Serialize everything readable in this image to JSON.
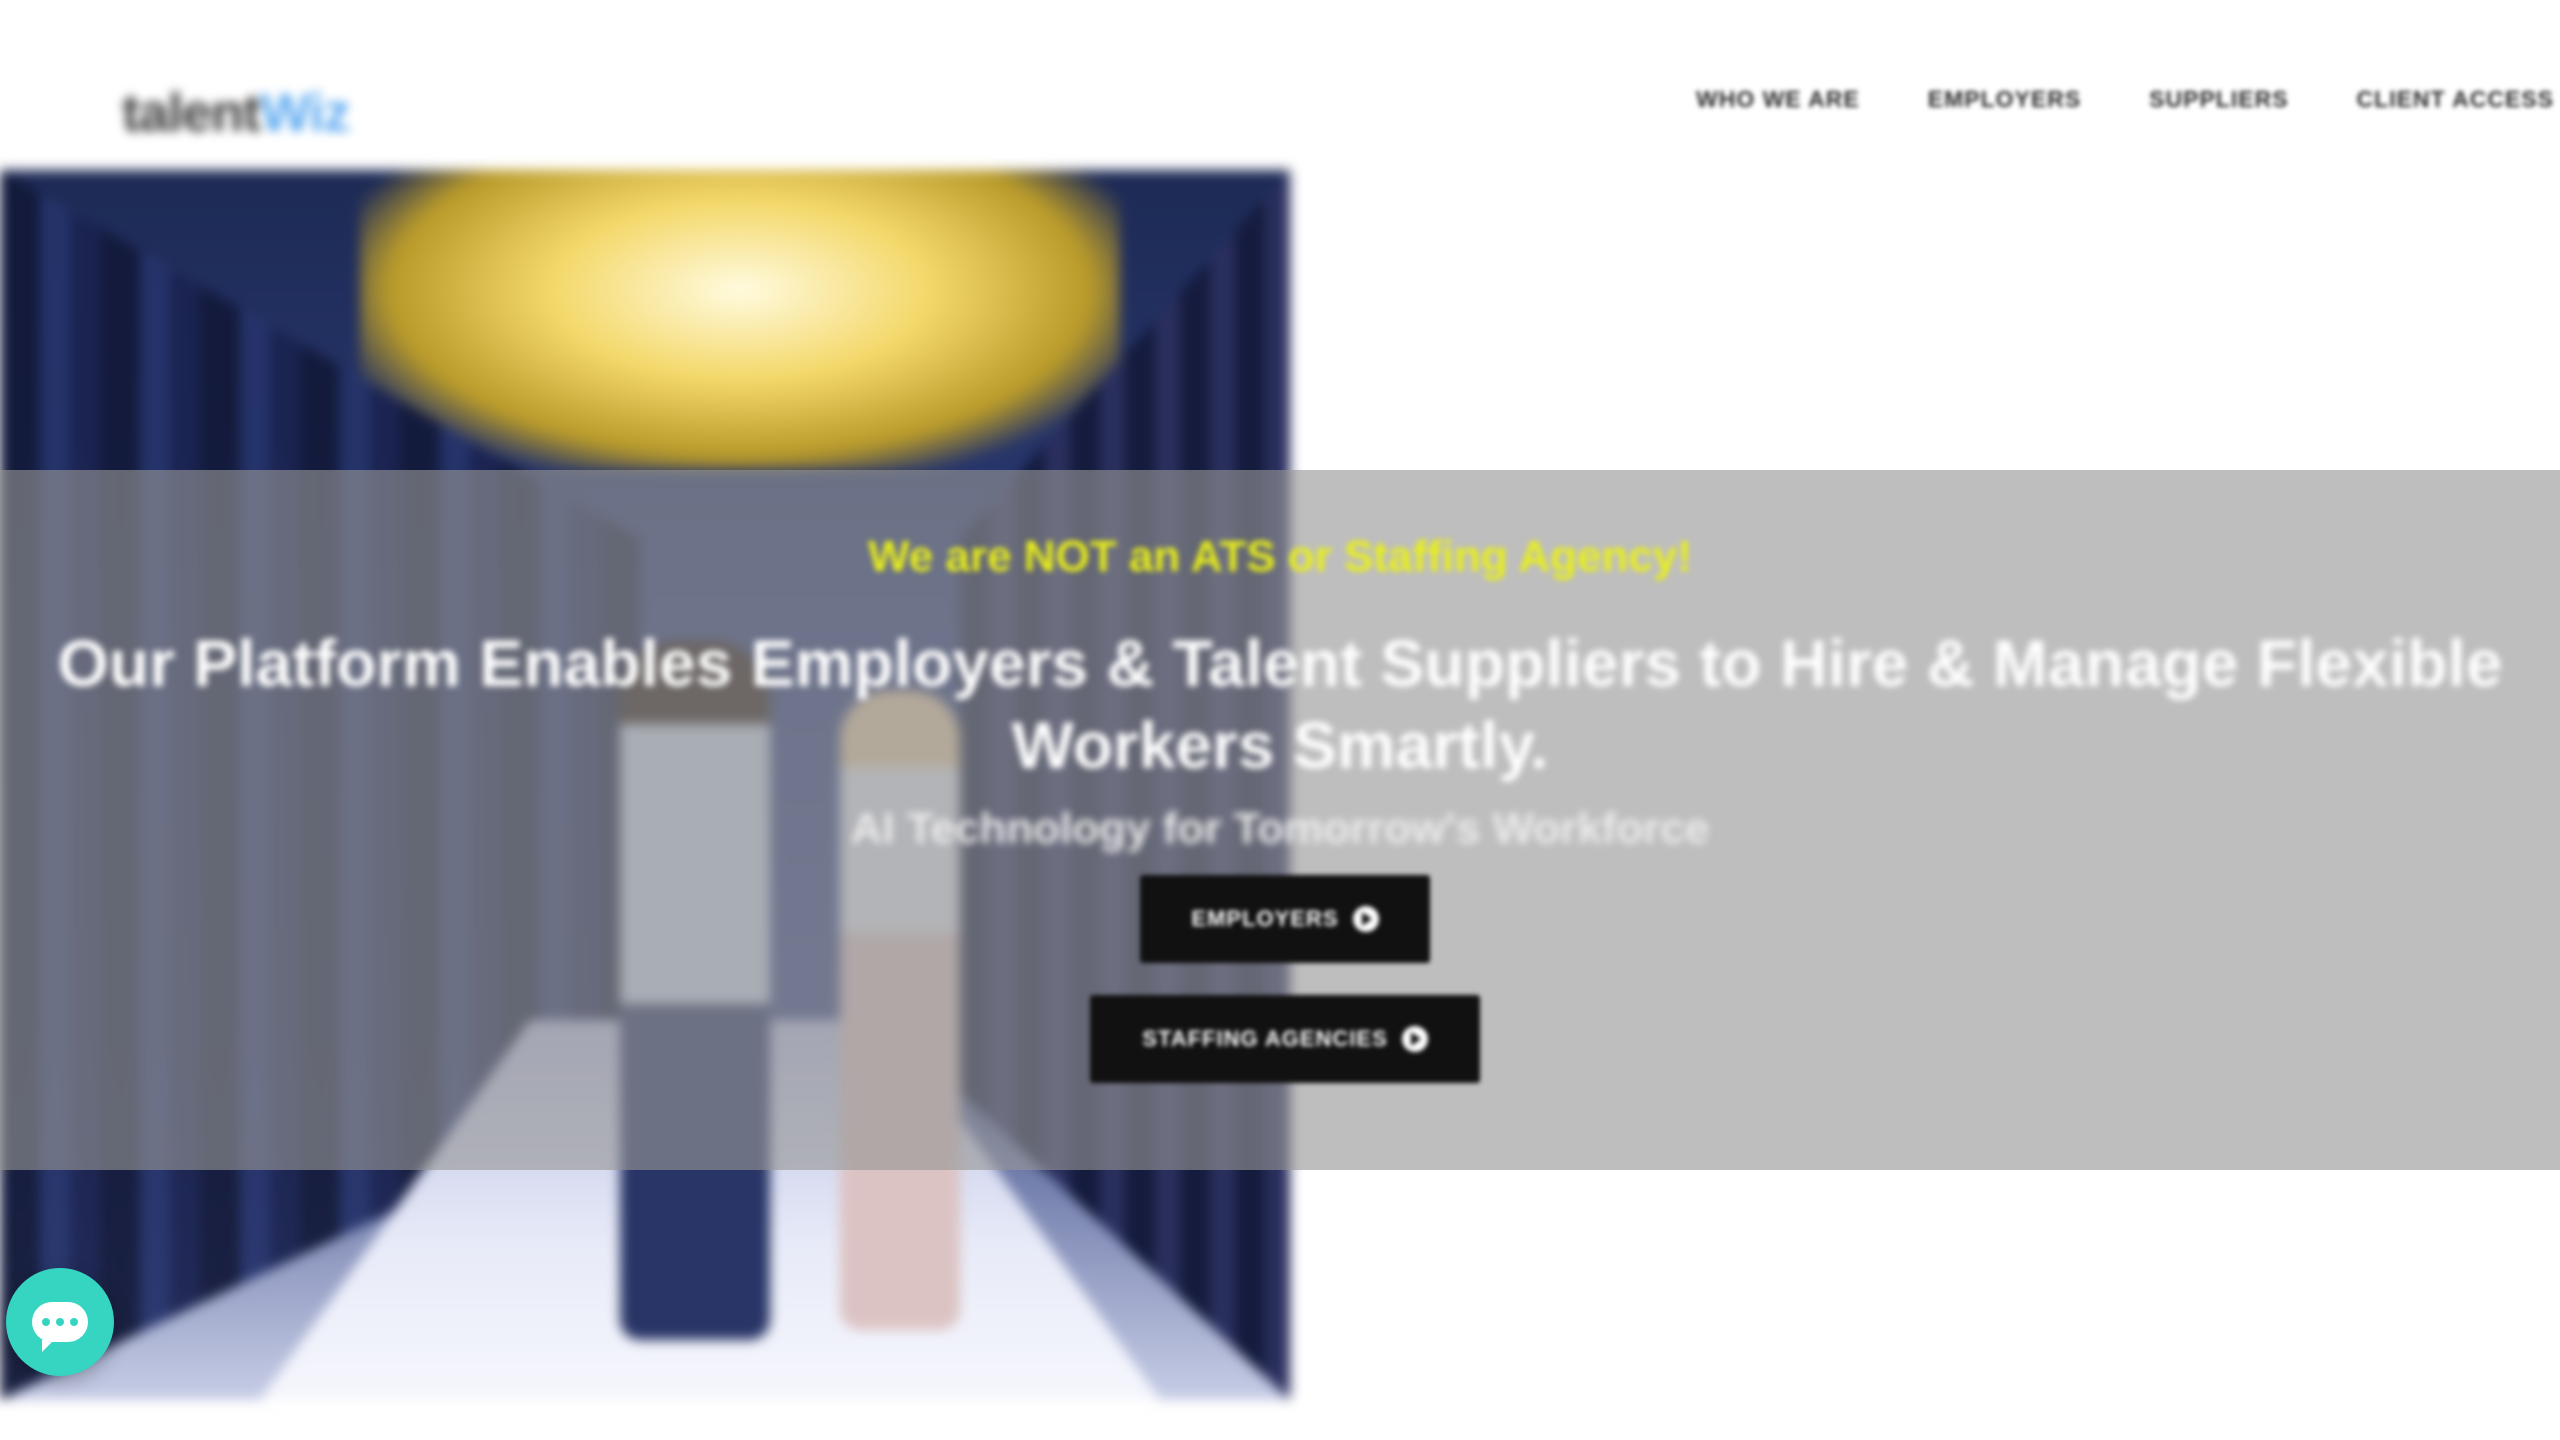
{
  "header": {
    "logo_part1": "talent",
    "logo_part2": "Wiz",
    "nav": [
      {
        "label": "WHO WE ARE"
      },
      {
        "label": "EMPLOYERS"
      },
      {
        "label": "SUPPLIERS"
      },
      {
        "label": "CLIENT ACCESS"
      }
    ]
  },
  "hero": {
    "eyebrow": "We are NOT an ATS or Staffing Agency!",
    "headline": "Our Platform Enables Employers & Talent Suppliers to Hire & Manage Flexible Workers Smartly.",
    "subheadline": "AI Technology for Tomorrow's Workforce",
    "buttons": {
      "employers": "EMPLOYERS",
      "agencies": "STAFFING AGENCIES"
    }
  },
  "colors": {
    "eyebrow": "#e8ef1a",
    "button_bg": "#111111",
    "chat_bg": "#35d5c2",
    "logo_accent": "#5aa8f0"
  },
  "icons": {
    "chat": "chat-bubble-icon",
    "button_arrow": "arrow-circle-right-icon"
  }
}
